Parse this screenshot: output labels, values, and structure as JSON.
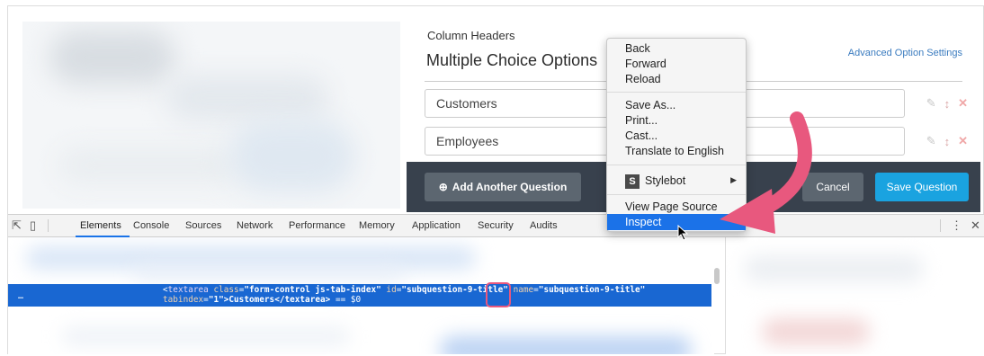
{
  "editor": {
    "column_headers_label": "Column Headers",
    "section_title": "Multiple Choice Options",
    "advanced_link": "Advanced Option Settings",
    "options": [
      {
        "value": "Customers"
      },
      {
        "value": "Employees"
      }
    ],
    "add_question_label": "Add Another Question",
    "cancel_label": "Cancel",
    "save_label": "Save Question"
  },
  "context_menu": {
    "items": [
      "Back",
      "Forward",
      "Reload",
      "Save As...",
      "Print...",
      "Cast...",
      "Translate to English",
      "Stylebot",
      "View Page Source",
      "Inspect"
    ],
    "highlighted": "Inspect"
  },
  "devtools": {
    "tabs": [
      "Elements",
      "Console",
      "Sources",
      "Network",
      "Performance",
      "Memory",
      "Application",
      "Security",
      "Audits"
    ],
    "active_tab": "Elements",
    "selected_line": {
      "open": "<",
      "tag": "textarea",
      "class_attr": "class",
      "class_val": "\"form-control js-tab-index\"",
      "id_attr": "id",
      "id_val": "\"subquestion-9-title\"",
      "name_attr": "name",
      "name_val": "\"subquestion-9-title\"",
      "tabindex_attr": "tabindex",
      "tabindex_val": "\"1\"",
      "content": ">Customers</textarea>",
      "suffix": "== $0"
    }
  },
  "colors": {
    "dark_bar": "#38414d",
    "save_blue": "#1aa3e0",
    "devtools_highlight": "#1967d2",
    "annotation_pink": "#e8587e"
  }
}
